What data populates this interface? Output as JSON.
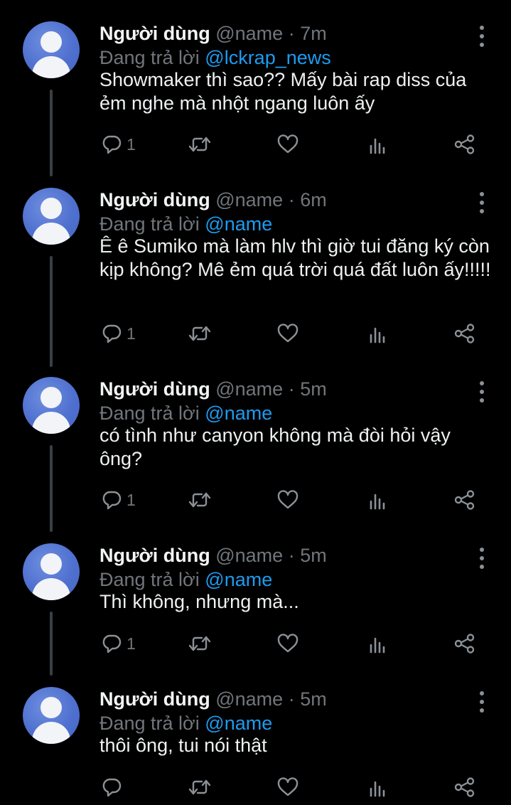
{
  "colors": {
    "background": "#000000",
    "mention": "#1d9bf0",
    "muted": "#71767b",
    "thread_line": "#3b3f44"
  },
  "icons": [
    "reply-icon",
    "retweet-icon",
    "like-icon",
    "views-icon",
    "share-icon",
    "more-icon",
    "avatar-icon"
  ],
  "tweets": [
    {
      "name": "Người dùng",
      "handle": "@name",
      "sep": "·",
      "time": "7m",
      "replying_prefix": "Đang trả lời",
      "replying_to": "@lckrap_news",
      "text": "Showmaker thì sao?? Mấy bài rap diss của ẻm nghe mà nhột ngang luôn ấy",
      "reply_count": "1"
    },
    {
      "name": "Người dùng",
      "handle": "@name",
      "sep": "·",
      "time": "6m",
      "replying_prefix": "Đang trả lời",
      "replying_to": "@name",
      "text": "Ê ê Sumiko mà làm hlv thì giờ tui đăng ký còn kịp không? Mê ẻm quá trời quá đất luôn ấy!!!!!",
      "reply_count": "1"
    },
    {
      "name": "Người dùng",
      "handle": "@name",
      "sep": "·",
      "time": "5m",
      "replying_prefix": "Đang trả lời",
      "replying_to": "@name",
      "text": "có tình như canyon không mà đòi hỏi vậy ông?",
      "reply_count": "1"
    },
    {
      "name": "Người dùng",
      "handle": "@name",
      "sep": "·",
      "time": "5m",
      "replying_prefix": "Đang trả lời",
      "replying_to": "@name",
      "text": "Thì không, nhưng mà...",
      "reply_count": "1"
    },
    {
      "name": "Người dùng",
      "handle": "@name",
      "sep": "·",
      "time": "5m",
      "replying_prefix": "Đang trả lời",
      "replying_to": "@name",
      "text": "thôi ông, tui nói thật",
      "reply_count": ""
    }
  ]
}
